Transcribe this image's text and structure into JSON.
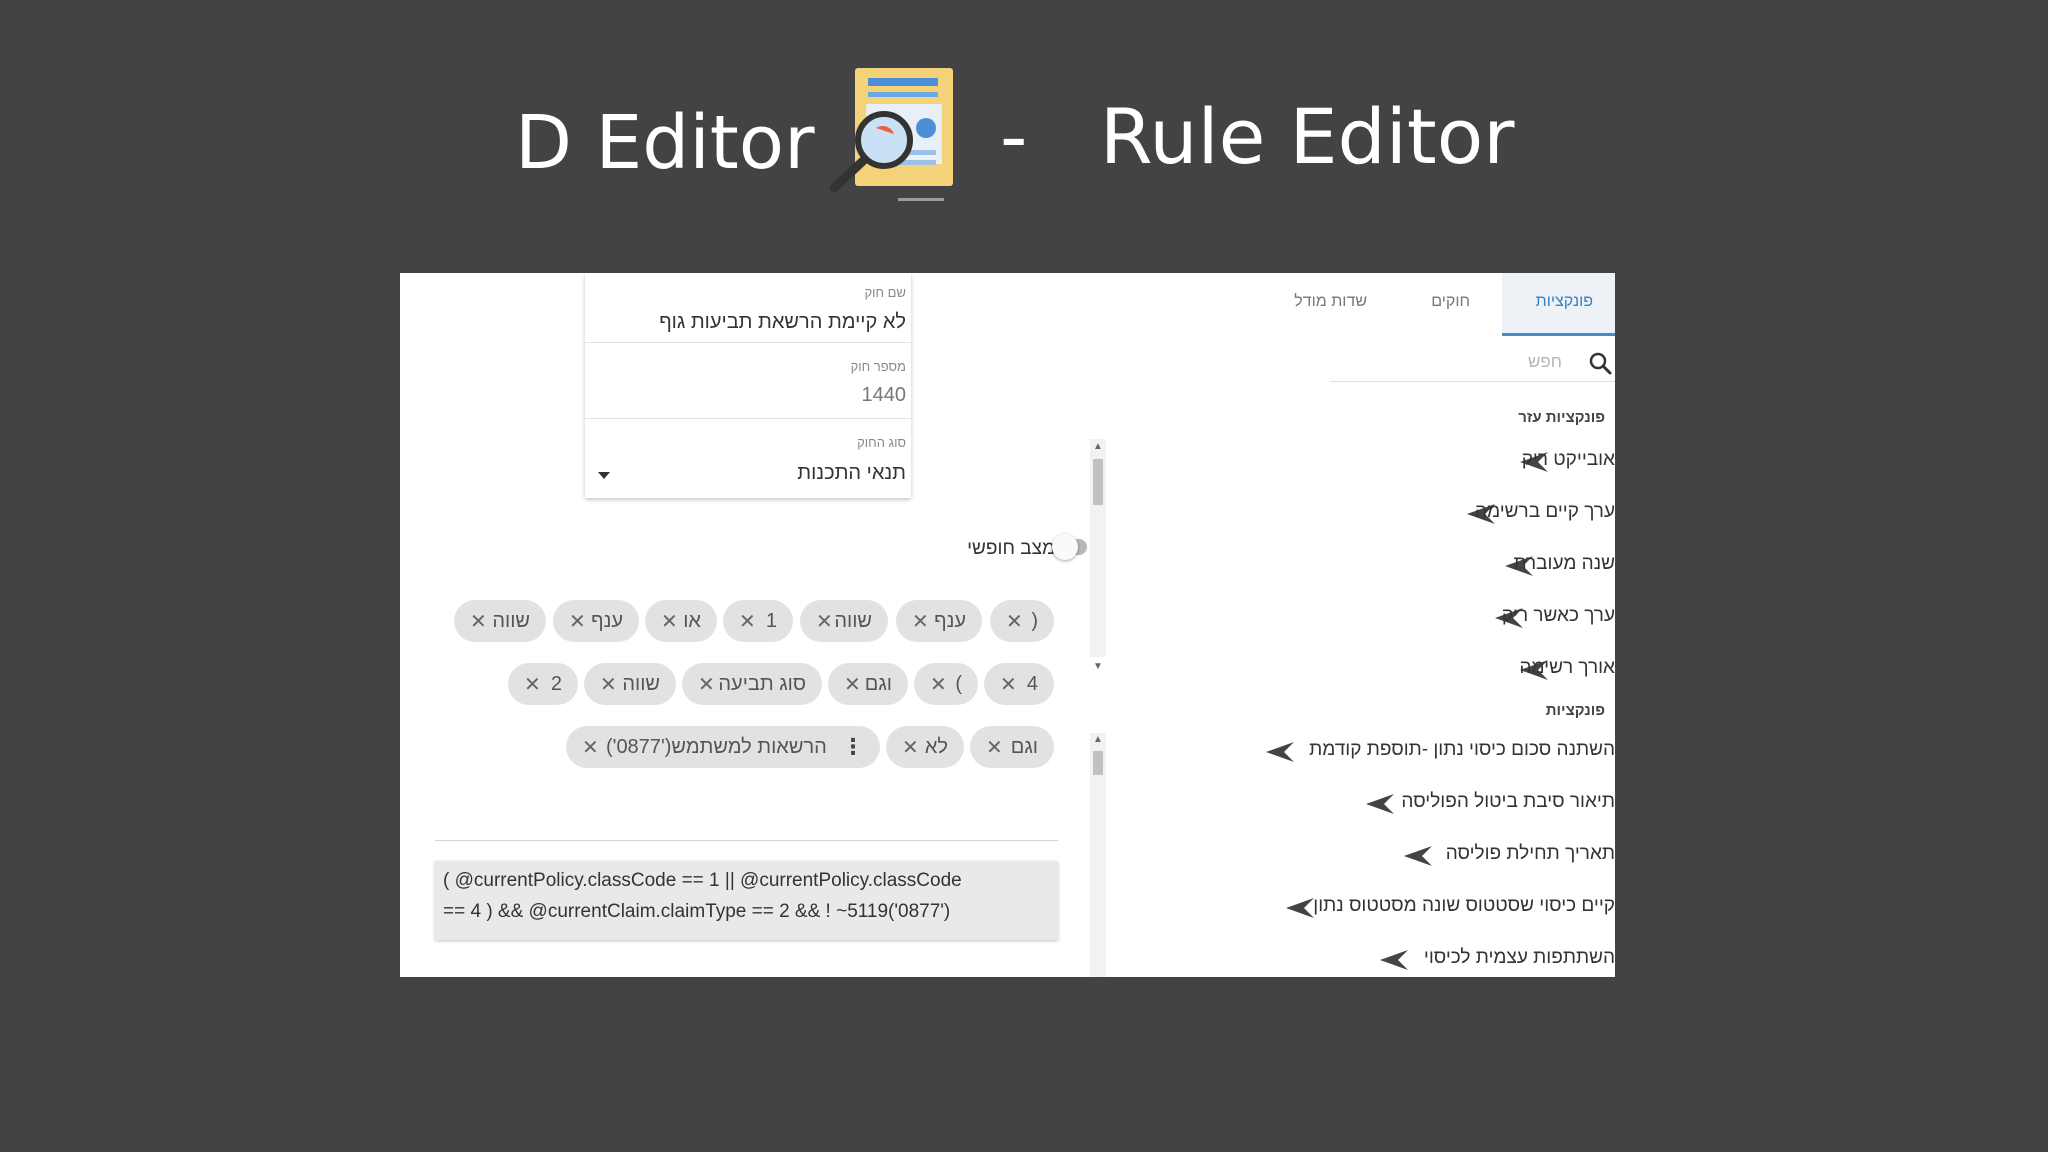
{
  "slide": {
    "title_left": "D Editor",
    "title_dash": "-",
    "title_right": "Rule Editor",
    "logo_icon": "document-magnifier-icon"
  },
  "form": {
    "rule_name_label": "שם חוק",
    "rule_name_value": "לא קיימת הרשאת תביעות גוף",
    "rule_number_label": "מספר חוק",
    "rule_number_value": "1440",
    "rule_type_label": "סוג החוק",
    "rule_type_value": "תנאי התכנות",
    "free_mode_label": "מצב חופשי",
    "free_mode_on": false
  },
  "chips": {
    "row1": [
      "(",
      "ענף",
      "שווה",
      "1",
      "או",
      "ענף",
      "שווה"
    ],
    "row2": [
      "4",
      ")",
      "וגם",
      "סוג תביעה",
      "שווה",
      "2"
    ],
    "row3": [
      "וגם",
      "לא",
      "הרשאות למשתמש('0877')"
    ]
  },
  "expression": {
    "line1": "( @currentPolicy.classCode == 1 || @currentPolicy.classCode",
    "line2": "== 4 ) && @currentClaim.claimType == 2 && ! ~5119('0877')"
  },
  "tabs": [
    "פונקציות",
    "חוקים",
    "שדות מודל"
  ],
  "active_tab": "פונקציות",
  "search_placeholder": "חפש",
  "sections": {
    "helpers_title": "פונקציות עזר",
    "helpers": [
      "אובייקט ריק",
      "ערך קיים ברשימה",
      "שנה מעוברת",
      "ערך כאשר ריק",
      "אורך רשימה"
    ],
    "functions_title": "פונקציות",
    "functions": [
      "השתנה סכום כיסוי נתון -תוספת קודמת",
      "תיאור סיבת ביטול הפוליסה",
      "תאריך תחילת פוליסה",
      "קיים כיסוי שסטטוס שונה מסטטוס נתון",
      "השתתפות עצמית לכיסוי"
    ]
  },
  "colors": {
    "background": "#434244",
    "accent": "#2f83c6",
    "chip": "#e2e2e2"
  }
}
